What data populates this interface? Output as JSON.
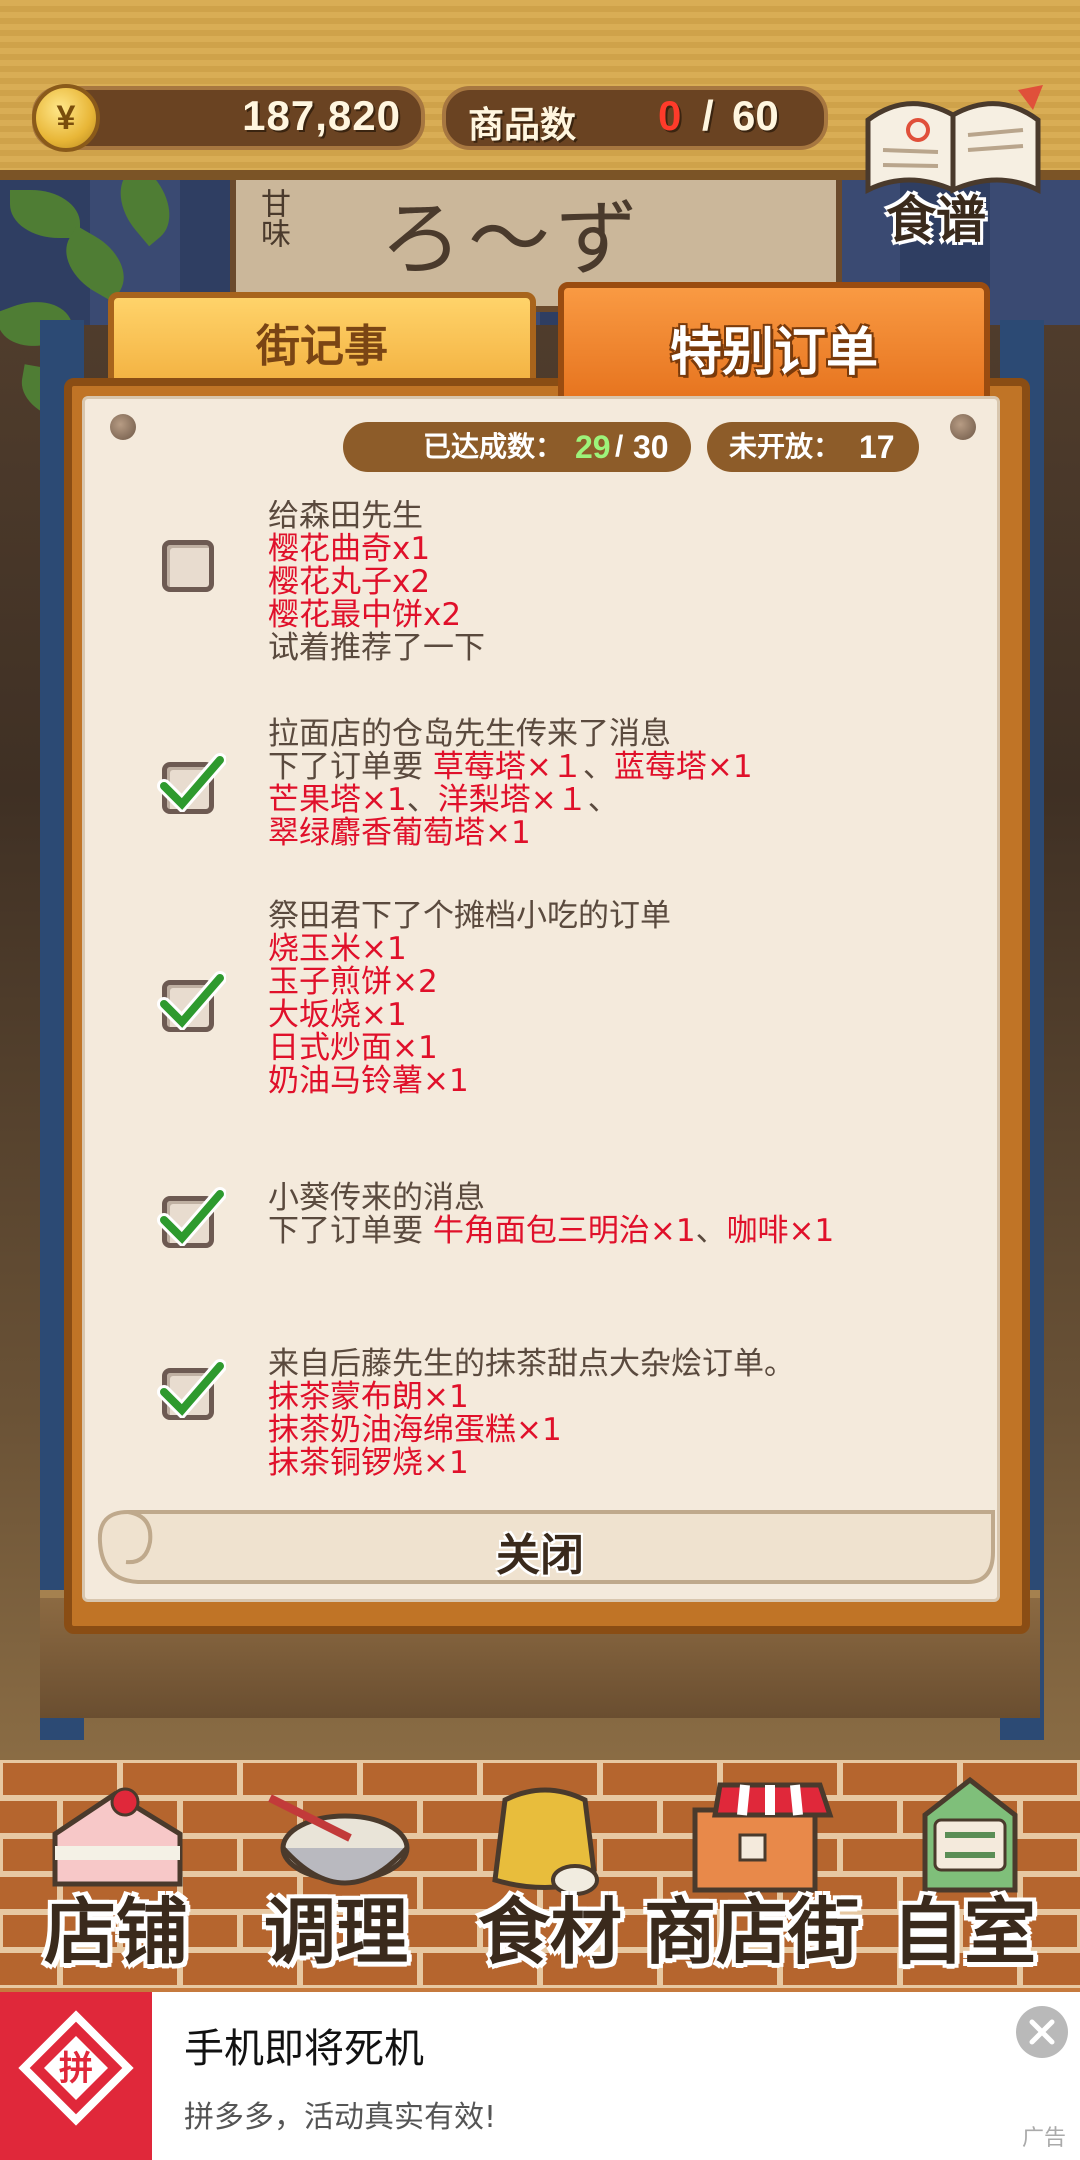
{
  "top_bar": {
    "currency_symbol": "¥",
    "money": "187,820",
    "goods_label": "商品数",
    "goods_count": "0",
    "goods_sep": "/",
    "goods_max": "60",
    "recipe_label": "食谱"
  },
  "tabs": [
    {
      "label": "街记事",
      "active": false
    },
    {
      "label": "特别订单",
      "active": true
    }
  ],
  "stats": {
    "achieved_label": "已达成数：",
    "achieved": "29",
    "sep": "/",
    "achieved_total": "30",
    "locked_label": "未开放：",
    "locked": "17"
  },
  "orders": [
    {
      "checked": false,
      "lines": [
        [
          {
            "t": "给森田先生",
            "red": false
          }
        ],
        [
          {
            "t": "樱花曲奇x1",
            "red": true
          }
        ],
        [
          {
            "t": "樱花丸子x2",
            "red": true
          }
        ],
        [
          {
            "t": "樱花最中饼x2",
            "red": true
          }
        ],
        [
          {
            "t": "试着推荐了一下",
            "red": false
          }
        ]
      ]
    },
    {
      "checked": true,
      "lines": [
        [
          {
            "t": "拉面店的仓岛先生传来了消息",
            "red": false
          }
        ],
        [
          {
            "t": "下了订单要 ",
            "red": false
          },
          {
            "t": "草莓塔×１",
            "red": true
          },
          {
            "t": "、",
            "red": false
          },
          {
            "t": "蓝莓塔×1",
            "red": true
          }
        ],
        [
          {
            "t": "芒果塔×1",
            "red": true
          },
          {
            "t": "、",
            "red": false
          },
          {
            "t": "洋梨塔×１",
            "red": true
          },
          {
            "t": "、",
            "red": false
          }
        ],
        [
          {
            "t": "翠绿麝香葡萄塔×1",
            "red": true
          }
        ]
      ]
    },
    {
      "checked": true,
      "lines": [
        [
          {
            "t": "祭田君下了个摊档小吃的订单",
            "red": false
          }
        ],
        [
          {
            "t": "烧玉米×1",
            "red": true
          }
        ],
        [
          {
            "t": "玉子煎饼×2",
            "red": true
          }
        ],
        [
          {
            "t": "大坂烧×1",
            "red": true
          }
        ],
        [
          {
            "t": "日式炒面×1",
            "red": true
          }
        ],
        [
          {
            "t": "奶油马铃薯×1",
            "red": true
          }
        ]
      ]
    },
    {
      "checked": true,
      "lines": [
        [
          {
            "t": "小葵传来的消息",
            "red": false
          }
        ],
        [
          {
            "t": "下了订单要 ",
            "red": false
          },
          {
            "t": "牛角面包三明治×1",
            "red": true
          },
          {
            "t": "、",
            "red": false
          },
          {
            "t": "咖啡×1",
            "red": true
          }
        ]
      ]
    },
    {
      "checked": true,
      "lines": [
        [
          {
            "t": "来自后藤先生的抹茶甜点大杂烩订单。",
            "red": false
          }
        ],
        [
          {
            "t": "抹茶蒙布朗×1",
            "red": true
          }
        ],
        [
          {
            "t": "抹茶奶油海绵蛋糕×1",
            "red": true
          }
        ],
        [
          {
            "t": "抹茶铜锣烧×1",
            "red": true
          }
        ]
      ]
    }
  ],
  "close_label": "关闭",
  "shop_sign": {
    "main": "ろ〜ず",
    "small": "甘味"
  },
  "nav": [
    {
      "label": "店铺",
      "icon": "cake-icon"
    },
    {
      "label": "调理",
      "icon": "whisk-bowl-icon"
    },
    {
      "label": "食材",
      "icon": "flour-sack-icon"
    },
    {
      "label": "商店街",
      "icon": "shop-icon"
    },
    {
      "label": "自室",
      "icon": "staff-only-door-icon"
    }
  ],
  "ad": {
    "title": "手机即将死机",
    "subtitle": "拼多多，活动真实有效!",
    "tag": "广告",
    "logo_text": "拼"
  },
  "colors": {
    "accent_red": "#e0102a",
    "tab_active": "#f0832c",
    "achieved_green": "#9df37a",
    "check_green": "#2e9a2e"
  }
}
